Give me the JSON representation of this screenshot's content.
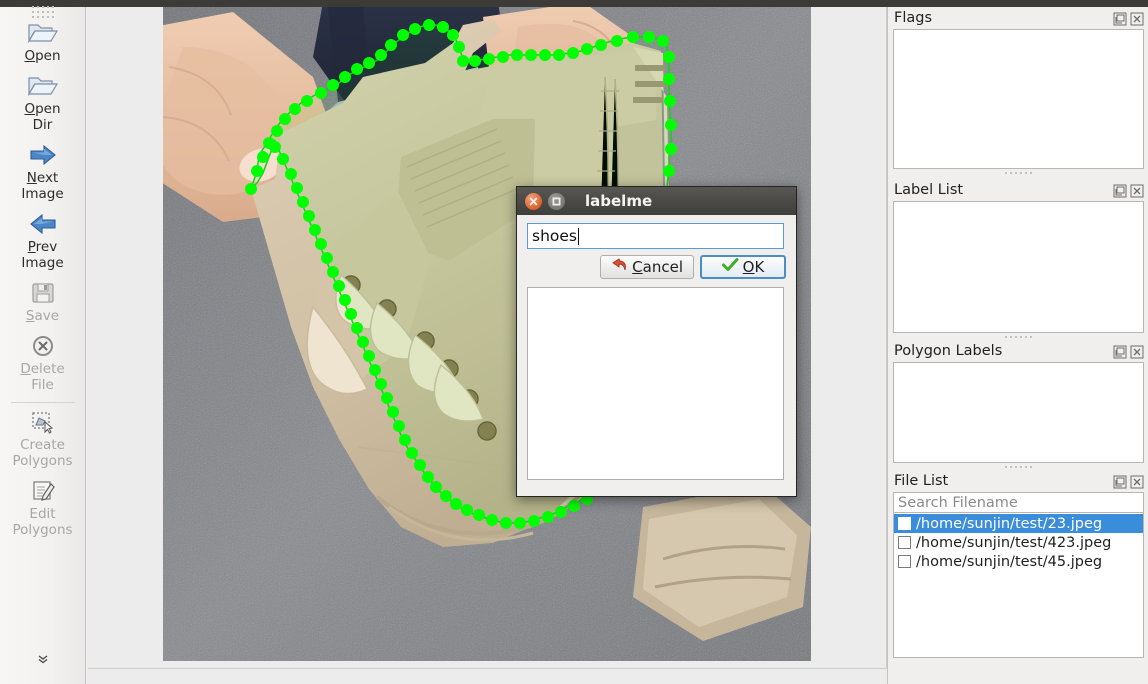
{
  "app": {
    "name": "labelme"
  },
  "toolbar": {
    "items": [
      {
        "label": "Open",
        "mnemonic": "O",
        "icon": "open-folder-icon",
        "enabled": true,
        "name": "open"
      },
      {
        "label": "Open Dir",
        "mnemonic": "O",
        "icon": "open-folder-icon",
        "enabled": true,
        "name": "open-dir"
      },
      {
        "label": "Next Image",
        "mnemonic": "N",
        "icon": "arrow-right-icon",
        "enabled": true,
        "name": "next-image"
      },
      {
        "label": "Prev Image",
        "mnemonic": "P",
        "icon": "arrow-left-icon",
        "enabled": true,
        "name": "prev-image"
      },
      {
        "label": "Save",
        "mnemonic": "S",
        "icon": "floppy-disk-icon",
        "enabled": false,
        "name": "save"
      },
      {
        "label": "Delete File",
        "mnemonic": "D",
        "icon": "delete-circle-icon",
        "enabled": false,
        "name": "delete-file"
      },
      {
        "label": "Create Polygons",
        "mnemonic": "",
        "icon": "create-polygon-icon",
        "enabled": false,
        "name": "create-polygons"
      },
      {
        "label": "Edit Polygons",
        "mnemonic": "",
        "icon": "edit-polygon-icon",
        "enabled": false,
        "name": "edit-polygons"
      }
    ],
    "more_label": "»"
  },
  "docks": [
    {
      "title": "Flags",
      "name": "flags"
    },
    {
      "title": "Label List",
      "name": "label-list"
    },
    {
      "title": "Polygon Labels",
      "name": "polygon-labels"
    },
    {
      "title": "File List",
      "name": "file-list"
    }
  ],
  "file_list": {
    "title": "File List",
    "search_placeholder": "Search Filename",
    "search_value": "",
    "files": [
      {
        "path": "/home/sunjin/test/23.jpeg",
        "checked": false,
        "selected": true
      },
      {
        "path": "/home/sunjin/test/423.jpeg",
        "checked": false,
        "selected": false
      },
      {
        "path": "/home/sunjin/test/45.jpeg",
        "checked": false,
        "selected": false
      }
    ]
  },
  "dialog": {
    "title": "labelme",
    "input_value": "shoes",
    "cancel_label": "Cancel",
    "cancel_mnemonic": "C",
    "ok_label": "OK",
    "ok_mnemonic": "O",
    "ok_focused": true,
    "suggestion_list": []
  },
  "canvas": {
    "image_name": "/home/sunjin/test/23.jpeg",
    "polygon_color": "#00ff00",
    "polygon_vertex_count": 94
  },
  "colors": {
    "selection_blue": "#3a8ddb",
    "polygon_green": "#00ff00",
    "titlebar_dark": "#4b4a46",
    "close_orange": "#d9622a",
    "panel_bg": "#f0efee"
  }
}
